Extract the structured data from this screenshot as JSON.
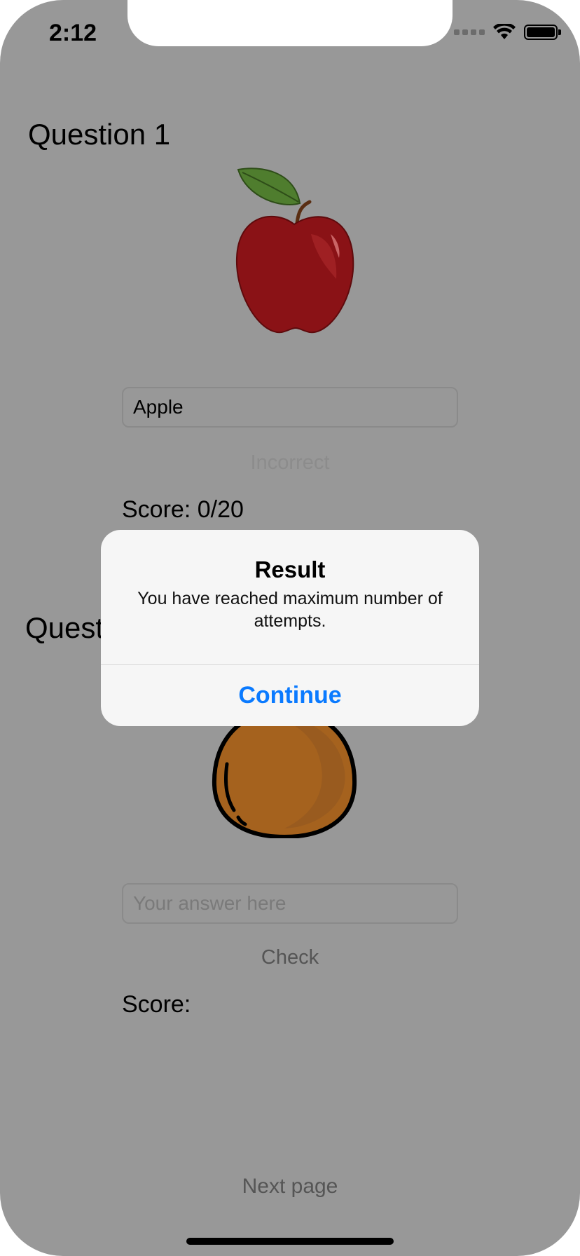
{
  "status_bar": {
    "time": "2:12"
  },
  "questions": [
    {
      "title": "Question 1",
      "image": "apple-image",
      "answer_value": "Apple",
      "feedback": "Incorrect",
      "score": "Score: 0/20"
    },
    {
      "title": "Quest",
      "image": "orange-image",
      "answer_placeholder": "Your answer here",
      "check_label": "Check",
      "score": "Score:"
    }
  ],
  "alert": {
    "title": "Result",
    "message": "You have reached maximum number of attempts.",
    "button": "Continue"
  },
  "footer": {
    "next_page": "Next page"
  },
  "colors": {
    "overlay_background": "#989898",
    "alert_background": "#f6f6f6",
    "alert_button": "#0a7aff",
    "apple_red": "#8a1216",
    "orange_fruit": "#a5621e"
  }
}
